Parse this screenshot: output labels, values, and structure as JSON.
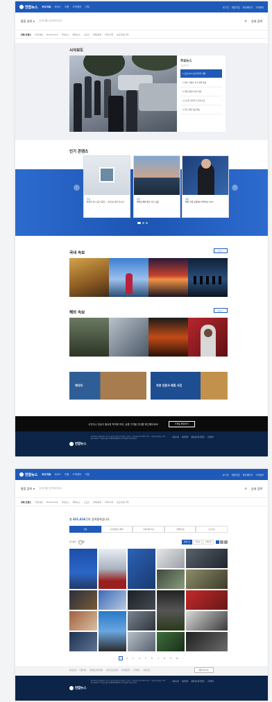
{
  "header": {
    "logo": "연합뉴스",
    "nav": [
      "보도자료",
      "서비스",
      "이용",
      "고객센터",
      "기업"
    ],
    "links": [
      "로그인",
      "회원가입",
      "마이페이지",
      "고객센터"
    ]
  },
  "search": {
    "scope": "통합 검색",
    "placeholder": "검색어를 입력해주세요",
    "detail": "상세 검색"
  },
  "categories": [
    "전체 콘텐츠",
    "사진/영상",
    "Multimedia",
    "국내뉴스",
    "해외뉴스",
    "스포츠",
    "연예/문화",
    "지역/사회",
    "보도자료/기타"
  ],
  "main_news": {
    "title": "시사보도",
    "panel_title": "주요뉴스",
    "panel_sub": "오늘의 이슈",
    "items": [
      "1  코로나19 신규 확진자 현황",
      "2  정부, 부동산 추가 대책 발표",
      "3  국회 본회의 법안 처리",
      "4  수도권 거리두기 단계 조정",
      "5  주요 경제 지표 발표"
    ]
  },
  "popular": {
    "title": "인기 콘텐츠",
    "cards": [
      {
        "cat": "문화",
        "text": "박물관 전시 공간 공개 ― 새 단장 마친 전시실"
      },
      {
        "cat": "여행",
        "text": "해질녘 해변 풍경 사진 모음"
      },
      {
        "cat": "경제",
        "text": "해외 경제 포럼에서 발언하는 CEO"
      }
    ]
  },
  "domestic": {
    "title": "국내 속보",
    "more": "더보기"
  },
  "overseas": {
    "title": "해외 속보",
    "more": "더보기"
  },
  "banners": [
    "에디터",
    "자연 인문사 제휴 사진"
  ],
  "notice": {
    "text": "사진이나 영상이 필요한 목적에 따라, 상품 가격을 안내를 확인해보세요!",
    "button": "가격표 확인하기"
  },
  "footer": {
    "logo": "연합뉴스",
    "text": "(03143) 서울특별시 종로구 율곡로2길 25 연합뉴스빌딩 · 대표전화 02-398-3114 · 사업자등록번호 101-81-00000 · Copyright YONHAPNEWS All rights reserved.",
    "links": [
      "회사소개",
      "이용약관",
      "개인정보처리방침",
      "고객센터"
    ]
  },
  "results": {
    "count_prefix": "총",
    "count": "421,416",
    "count_suffix": "건의 검색결과입니다.",
    "tabs": [
      "전체",
      "사진/영상/그래픽",
      "국내/국외 속보",
      "그래픽/인포",
      "보도자료"
    ],
    "filter_label": "중복제외",
    "sort": [
      "정확도순",
      "최신순",
      "오래된순"
    ],
    "pages": [
      "‹",
      "1",
      "2",
      "3",
      "4",
      "5",
      "6",
      "7",
      "8",
      "9",
      "10",
      "›"
    ]
  },
  "sitemap": [
    "회사소개",
    "이용약관",
    "개인정보처리방침",
    "청소년보호정책",
    "저작권정책",
    "고객센터",
    "사이트맵"
  ],
  "family": "패밀리사이트"
}
